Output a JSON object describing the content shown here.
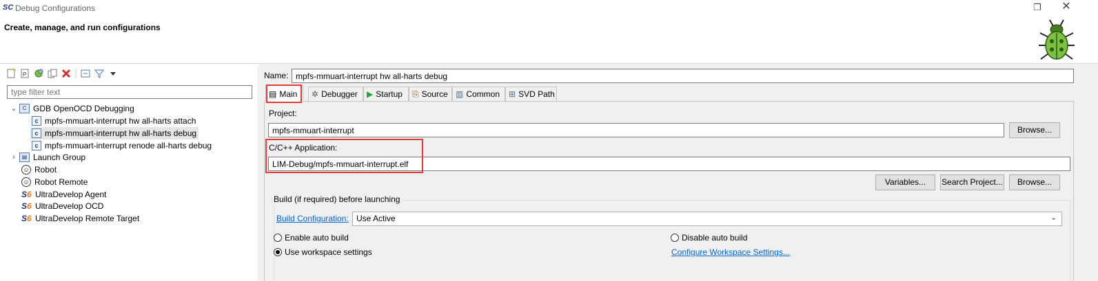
{
  "window": {
    "app_logo": "SC",
    "title": "Debug Configurations",
    "restore_glyph": "❐",
    "close_glyph": "✕"
  },
  "header": {
    "title": "Create, manage, and run configurations"
  },
  "left": {
    "filter_placeholder": "type filter text",
    "tree": [
      {
        "label": "GDB OpenOCD Debugging",
        "icon": "gdb-config-icon",
        "glyph": "C"
      },
      {
        "label": "mpfs-mmuart-interrupt hw all-harts attach",
        "icon": "config-file-icon",
        "glyph": "c"
      },
      {
        "label": "mpfs-mmuart-interrupt hw all-harts debug",
        "icon": "config-file-icon",
        "glyph": "c"
      },
      {
        "label": "mpfs-mmuart-interrupt renode all-harts debug",
        "icon": "config-file-icon",
        "glyph": "c"
      },
      {
        "label": "Launch Group",
        "icon": "launch-group-icon",
        "glyph": "▤"
      },
      {
        "label": "Robot",
        "icon": "robot-icon",
        "glyph": "☺"
      },
      {
        "label": "Robot Remote",
        "icon": "robot-icon",
        "glyph": "☺"
      },
      {
        "label": "UltraDevelop Agent",
        "icon": "ultradevelop-icon",
        "glyph": "S"
      },
      {
        "label": "UltraDevelop OCD",
        "icon": "ultradevelop-icon",
        "glyph": "S"
      },
      {
        "label": "UltraDevelop Remote Target",
        "icon": "ultradevelop-icon",
        "glyph": "S"
      }
    ],
    "expanded_chevron": "⌄",
    "collapsed_chevron": "›"
  },
  "main": {
    "name_label": "Name:",
    "name_value": "mpfs-mmuart-interrupt hw all-harts debug",
    "tabs": [
      {
        "label": "Main",
        "glyph": "▤"
      },
      {
        "label": "Debugger",
        "glyph": "✲"
      },
      {
        "label": "Startup",
        "glyph": "▶"
      },
      {
        "label": "Source",
        "glyph": "⎘"
      },
      {
        "label": "Common",
        "glyph": "▥"
      },
      {
        "label": "SVD Path",
        "glyph": "⊞"
      }
    ],
    "project_label": "Project:",
    "project_value": "mpfs-mmuart-interrupt",
    "browse_label": "Browse...",
    "app_label": "C/C++ Application:",
    "app_value": "LIM-Debug/mpfs-mmuart-interrupt.elf",
    "variables_label": "Variables...",
    "search_project_label": "Search Project...",
    "browse2_label": "Browse...",
    "build_group_label": "Build (if required) before launching",
    "build_config_link": "Build Configuration:",
    "build_config_value": "Use Active",
    "combo_arrow": "⌄",
    "enable_auto_build": "Enable auto build",
    "disable_auto_build": "Disable auto build",
    "use_workspace_settings": "Use workspace settings",
    "configure_workspace_link": "Configure Workspace Settings...",
    "selected_build_option": "Use workspace settings"
  },
  "colors": {
    "highlight_box": "#e53935",
    "link": "#0066cc",
    "selection": "#e5e5e5"
  }
}
